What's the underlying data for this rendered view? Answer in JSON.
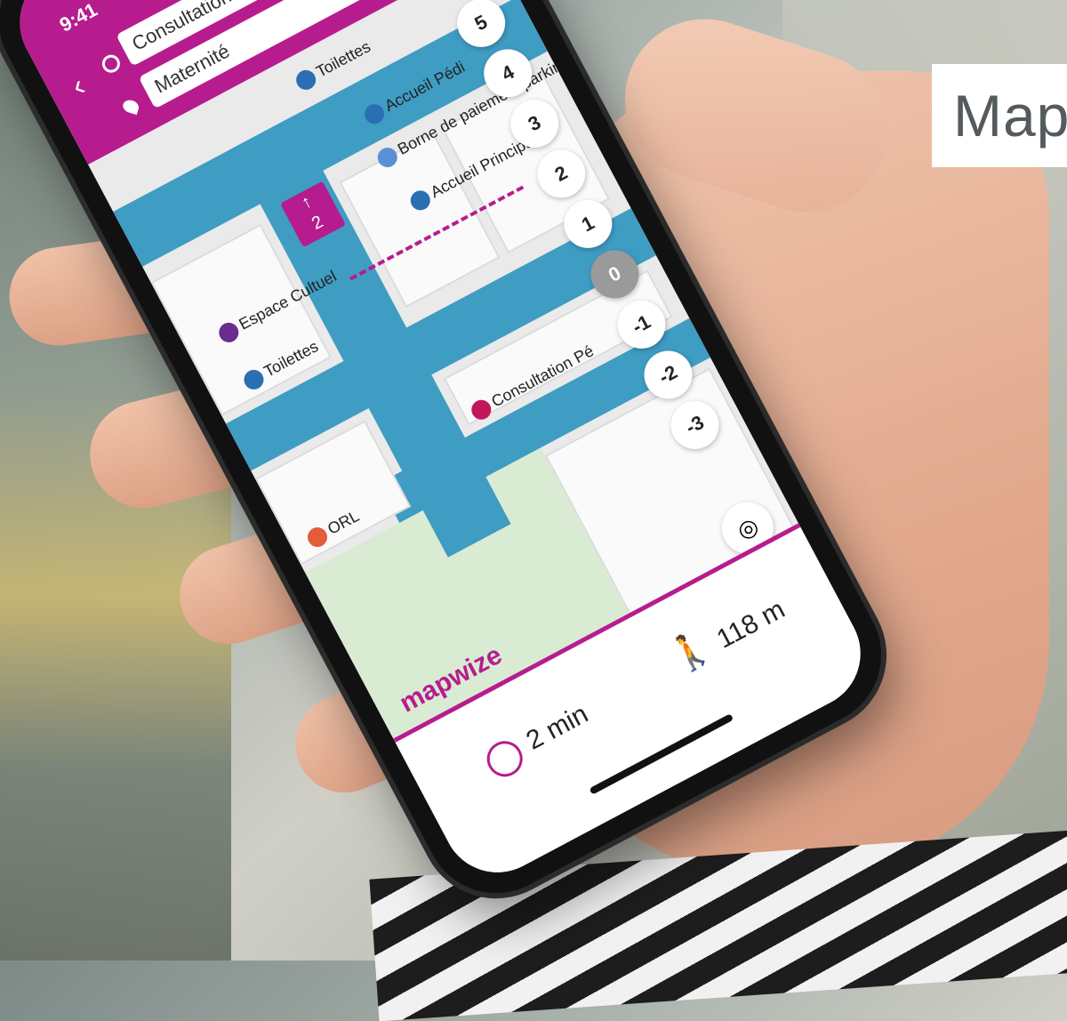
{
  "overlay": {
    "title": "Map"
  },
  "status_bar": {
    "time": "9:41"
  },
  "route_form": {
    "origin_value": "Consultation Pédiatrie",
    "destination_value": "Maternité"
  },
  "map": {
    "labels": {
      "toilettes_top": "Toilettes",
      "accueil": "Accueil Pédi",
      "borne": "Borne de paiement parking",
      "accueil_principal": "Accueil Principal",
      "espace_cultuel": "Espace Cultuel",
      "toilettes_mid": "Toilettes",
      "consultation": "Consultation Pé",
      "orl": "ORL"
    },
    "elevator": {
      "floor": "2",
      "arrow": "↑"
    }
  },
  "floors": [
    "5",
    "4",
    "3",
    "2",
    "1",
    "0",
    "-1",
    "-2",
    "-3"
  ],
  "active_floor": "0",
  "brand": {
    "logo": "mapwize",
    "accent": "#b71c8e",
    "corridor": "#3f9cc3"
  },
  "footer": {
    "duration": "2 min",
    "distance": "118 m"
  }
}
